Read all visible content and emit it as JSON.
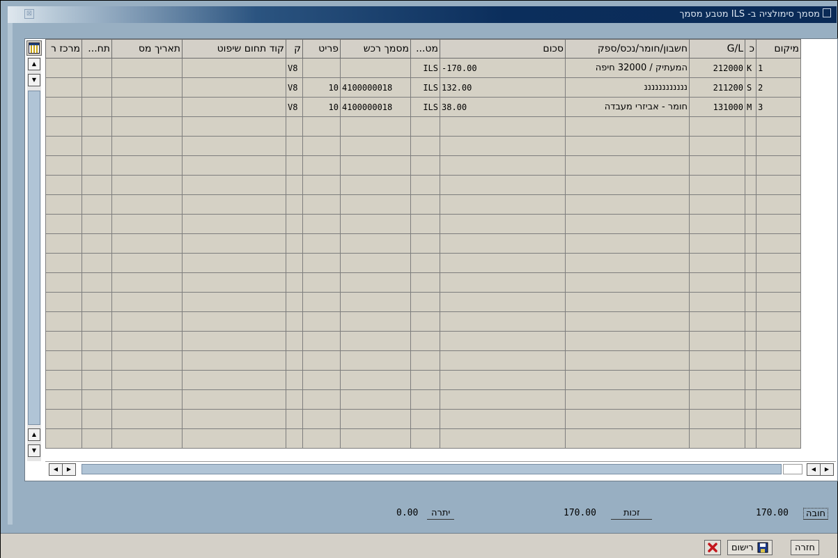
{
  "window": {
    "title": "מסמך סימולציה ב- ILS מטבע מסמך",
    "close_glyph": "⊠"
  },
  "table": {
    "columns": [
      "מיקום",
      "כ",
      "G/L",
      "חשבון/חומר/נכס/ספק",
      "סכום",
      "מט...",
      "מסמך רכש",
      "פריט",
      "ק",
      "קוד תחום שיפוט",
      "תאריך מס",
      "תח...",
      "מרכז ר"
    ],
    "rows": [
      {
        "pos": "1",
        "key": "K",
        "gl": "212000",
        "acct": "המעתיק / 32000 חיפה",
        "amount": "-170.00",
        "curr": "ILS",
        "po": "",
        "item": "",
        "tax": "V8"
      },
      {
        "pos": "2",
        "key": "S",
        "gl": "211200",
        "acct": "ננננננננננננ",
        "amount": "132.00",
        "curr": "ILS",
        "po": "4100000018",
        "item": "10",
        "tax": "V8"
      },
      {
        "pos": "3",
        "key": "M",
        "gl": "131000",
        "acct": "חומר - אביזרי מעבדה",
        "amount": "38.00",
        "curr": "ILS",
        "po": "4100000018",
        "item": "10",
        "tax": "V8"
      }
    ]
  },
  "totals": {
    "debit_label": "חובה",
    "debit_value": "170.00",
    "credit_label": "זכות",
    "credit_value": "170.00",
    "balance_label": "יתרה",
    "balance_value": "0.00"
  },
  "buttons": {
    "back_label": "חזרה",
    "post_label": "רישום"
  },
  "colors": {
    "title_dark": "#0b2e5c",
    "window_bg": "#98afc2",
    "grid_bg": "#d5d1c5"
  }
}
